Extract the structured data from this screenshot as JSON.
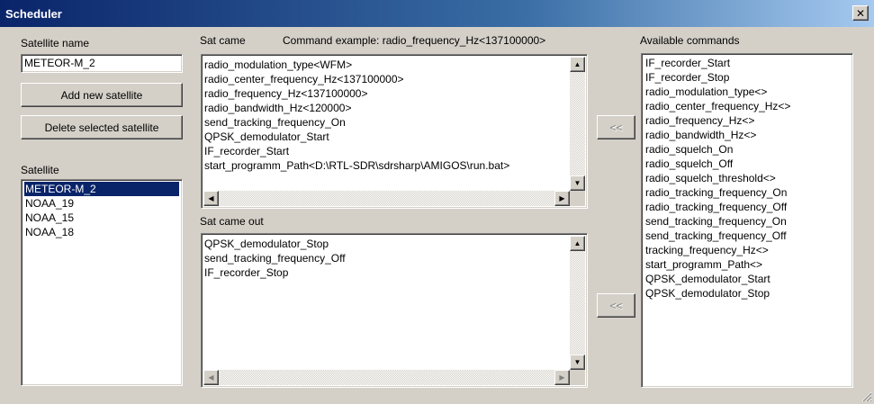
{
  "window": {
    "title": "Scheduler",
    "close_glyph": "✕"
  },
  "satellite_name": {
    "label": "Satellite name",
    "value": "METEOR-M_2"
  },
  "buttons": {
    "add": "Add new satellite",
    "delete": "Delete selected satellite",
    "move_in": "<<",
    "move_out": "<<"
  },
  "satellites": {
    "label": "Satellite",
    "items": [
      "METEOR-M_2",
      "NOAA_19",
      "NOAA_15",
      "NOAA_18"
    ],
    "selected": "METEOR-M_2"
  },
  "sat_came": {
    "label": "Sat came",
    "example": "Command example: radio_frequency_Hz<137100000>",
    "lines": [
      "radio_modulation_type<WFM>",
      "radio_center_frequency_Hz<137100000>",
      "radio_frequency_Hz<137100000>",
      "radio_bandwidth_Hz<120000>",
      "send_tracking_frequency_On",
      "QPSK_demodulator_Start",
      "IF_recorder_Start",
      "start_programm_Path<D:\\RTL-SDR\\sdrsharp\\AMIGOS\\run.bat>"
    ]
  },
  "sat_came_out": {
    "label": "Sat came out",
    "lines": [
      "QPSK_demodulator_Stop",
      "send_tracking_frequency_Off",
      "IF_recorder_Stop"
    ]
  },
  "available_commands": {
    "label": "Available commands",
    "items": [
      "IF_recorder_Start",
      "IF_recorder_Stop",
      "radio_modulation_type<>",
      "radio_center_frequency_Hz<>",
      "radio_frequency_Hz<>",
      "radio_bandwidth_Hz<>",
      "radio_squelch_On",
      "radio_squelch_Off",
      "radio_squelch_threshold<>",
      "radio_tracking_frequency_On",
      "radio_tracking_frequency_Off",
      "send_tracking_frequency_On",
      "send_tracking_frequency_Off",
      "tracking_frequency_Hz<>",
      "start_programm_Path<>",
      "QPSK_demodulator_Start",
      "QPSK_demodulator_Stop"
    ]
  },
  "scroll_glyphs": {
    "up": "▲",
    "down": "▼",
    "left": "◀",
    "right": "▶"
  }
}
